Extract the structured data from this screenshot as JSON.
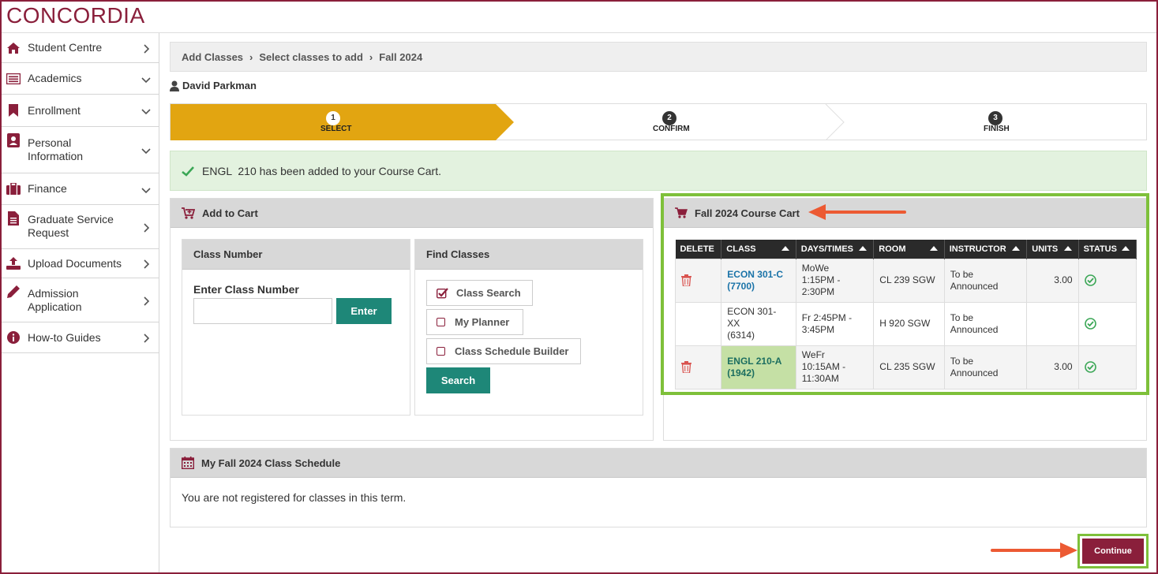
{
  "brand": {
    "logo_text": "CONCORDIA",
    "accent": "#8a1f3b"
  },
  "sidebar": {
    "items": [
      {
        "label": "Student Centre",
        "icon": "home-icon",
        "chevron": "right"
      },
      {
        "label": "Academics",
        "icon": "list-icon",
        "chevron": "down"
      },
      {
        "label": "Enrollment",
        "icon": "bookmark-icon",
        "chevron": "down"
      },
      {
        "label": "Personal Information",
        "label_line1": "Personal",
        "label_line2": "Information",
        "icon": "id-card-icon",
        "chevron": "down"
      },
      {
        "label": "Finance",
        "icon": "briefcase-icon",
        "chevron": "down"
      },
      {
        "label": "Graduate Service Request",
        "label_line1": "Graduate Service",
        "label_line2": "Request",
        "icon": "document-icon",
        "chevron": "right"
      },
      {
        "label": "Upload Documents",
        "icon": "upload-icon",
        "chevron": "right"
      },
      {
        "label": "Admission Application",
        "label_line1": "Admission",
        "label_line2": "Application",
        "icon": "pencil-icon",
        "chevron": "right"
      },
      {
        "label": "How-to Guides",
        "icon": "info-icon",
        "chevron": "right"
      }
    ]
  },
  "breadcrumb": [
    "Add Classes",
    "Select classes to add",
    "Fall 2024"
  ],
  "user": {
    "name": "David Parkman"
  },
  "steps": [
    {
      "num": "1",
      "label": "SELECT",
      "active": true
    },
    {
      "num": "2",
      "label": "CONFIRM",
      "active": false
    },
    {
      "num": "3",
      "label": "FINISH",
      "active": false
    }
  ],
  "alert": {
    "message": "ENGL  210 has been added to your Course Cart."
  },
  "add_to_cart": {
    "title": "Add to Cart",
    "class_number": {
      "title": "Class Number",
      "label": "Enter Class Number",
      "value": "",
      "button": "Enter"
    },
    "find_classes": {
      "title": "Find Classes",
      "options": [
        {
          "label": "Class Search",
          "checked": true
        },
        {
          "label": "My Planner",
          "checked": false
        },
        {
          "label": "Class Schedule Builder",
          "checked": false
        }
      ],
      "button": "Search"
    }
  },
  "cart": {
    "title": "Fall 2024 Course Cart",
    "columns": [
      "DELETE",
      "CLASS",
      "DAYS/TIMES",
      "ROOM",
      "INSTRUCTOR",
      "UNITS",
      "STATUS"
    ],
    "rows": [
      {
        "deletable": true,
        "class_line1": "ECON 301-C",
        "class_line2": "(7700)",
        "class_line3": "",
        "link": true,
        "highlight": false,
        "days_line1": "MoWe",
        "days_line2": "1:15PM -",
        "days_line3": "2:30PM",
        "room": "CL 239 SGW",
        "instructor_line1": "To be",
        "instructor_line2": "Announced",
        "units": "3.00",
        "status": "check-circle-icon"
      },
      {
        "deletable": false,
        "class_line1": "ECON 301-",
        "class_line2": "XX",
        "class_line3": "(6314)",
        "link": false,
        "highlight": false,
        "days_line1": "Fr 2:45PM -",
        "days_line2": "3:45PM",
        "days_line3": "",
        "room": "H 920 SGW",
        "instructor_line1": "To be",
        "instructor_line2": "Announced",
        "units": "",
        "status": "check-circle-icon"
      },
      {
        "deletable": true,
        "class_line1": "ENGL 210-A",
        "class_line2": "(1942)",
        "class_line3": "",
        "link": true,
        "highlight": true,
        "days_line1": "WeFr",
        "days_line2": "10:15AM -",
        "days_line3": "11:30AM",
        "room": "CL 235 SGW",
        "instructor_line1": "To be",
        "instructor_line2": "Announced",
        "units": "3.00",
        "status": "check-circle-icon"
      }
    ]
  },
  "schedule": {
    "title": "My Fall 2024 Class Schedule",
    "message": "You are not registered for classes in this term."
  },
  "actions": {
    "continue_label": "Continue"
  },
  "colors": {
    "step_active": "#e2a511",
    "teal": "#1e8778",
    "highlight_green": "#7ec03a",
    "arrow": "#ec5a33",
    "success": "#3aa655"
  }
}
